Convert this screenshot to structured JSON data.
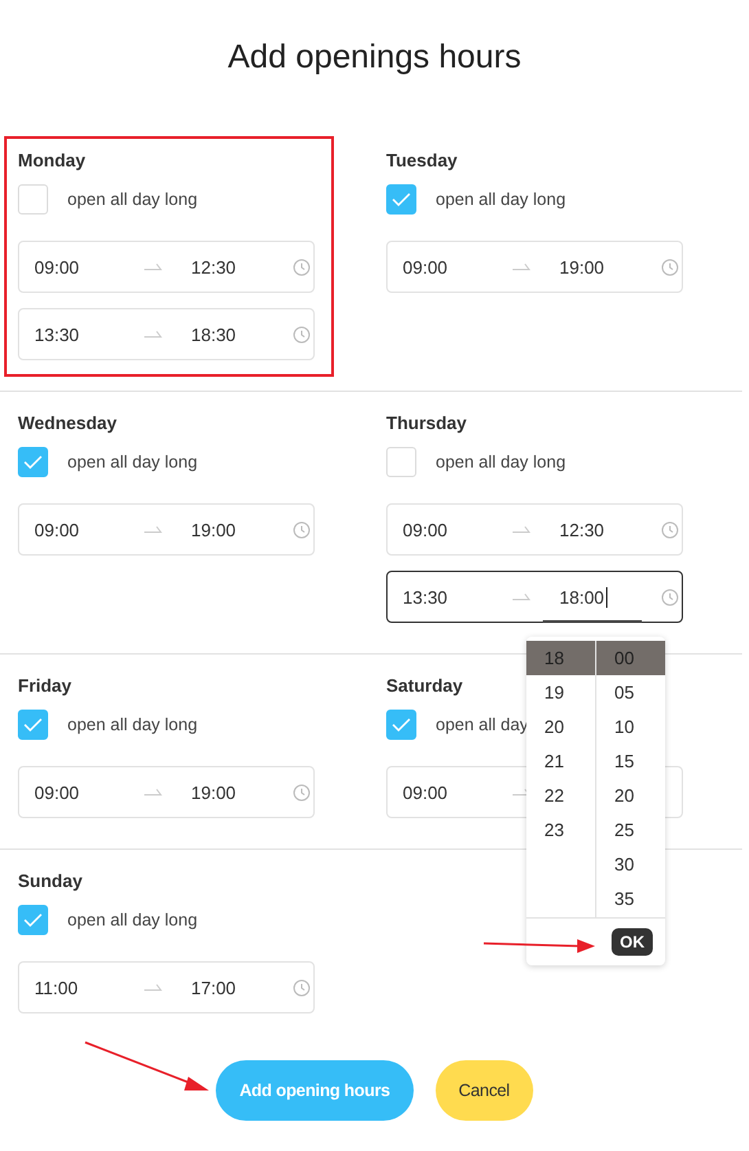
{
  "title": "Add openings hours",
  "rows": [
    {
      "days": [
        {
          "name": "Monday",
          "highlighted": true,
          "all_day": false,
          "all_day_label": "open all day long",
          "ranges": [
            {
              "from": "09:00",
              "to": "12:30",
              "active": false
            },
            {
              "from": "13:30",
              "to": "18:30",
              "active": false
            }
          ]
        },
        {
          "name": "Tuesday",
          "highlighted": false,
          "all_day": true,
          "all_day_label": "open all day long",
          "ranges": [
            {
              "from": "09:00",
              "to": "19:00",
              "active": false
            }
          ]
        }
      ]
    },
    {
      "days": [
        {
          "name": "Wednesday",
          "highlighted": false,
          "all_day": true,
          "all_day_label": "open all day long",
          "ranges": [
            {
              "from": "09:00",
              "to": "19:00",
              "active": false
            }
          ]
        },
        {
          "name": "Thursday",
          "highlighted": false,
          "all_day": false,
          "all_day_label": "open all day long",
          "ranges": [
            {
              "from": "09:00",
              "to": "12:30",
              "active": false
            },
            {
              "from": "13:30",
              "to": "18:00",
              "active": true
            }
          ]
        }
      ]
    },
    {
      "days": [
        {
          "name": "Friday",
          "highlighted": false,
          "all_day": true,
          "all_day_label": "open all day long",
          "ranges": [
            {
              "from": "09:00",
              "to": "19:00",
              "active": false
            }
          ]
        },
        {
          "name": "Saturday",
          "highlighted": false,
          "all_day": true,
          "all_day_label": "open all day",
          "ranges": [
            {
              "from": "09:00",
              "active": false
            }
          ]
        }
      ]
    },
    {
      "days": [
        {
          "name": "Sunday",
          "highlighted": false,
          "all_day": true,
          "all_day_label": "open all day long",
          "ranges": [
            {
              "from": "11:00",
              "to": "17:00",
              "active": false
            }
          ]
        }
      ]
    }
  ],
  "time_picker": {
    "hours": [
      {
        "label": "18",
        "selected": true
      },
      {
        "label": "19",
        "selected": false
      },
      {
        "label": "20",
        "selected": false
      },
      {
        "label": "21",
        "selected": false
      },
      {
        "label": "22",
        "selected": false
      },
      {
        "label": "23",
        "selected": false
      }
    ],
    "minutes": [
      {
        "label": "00",
        "selected": true
      },
      {
        "label": "05",
        "selected": false
      },
      {
        "label": "10",
        "selected": false
      },
      {
        "label": "15",
        "selected": false
      },
      {
        "label": "20",
        "selected": false
      },
      {
        "label": "25",
        "selected": false
      },
      {
        "label": "30",
        "selected": false
      },
      {
        "label": "35",
        "selected": false
      }
    ],
    "ok": "OK"
  },
  "buttons": {
    "submit": "Add opening hours",
    "cancel": "Cancel"
  }
}
